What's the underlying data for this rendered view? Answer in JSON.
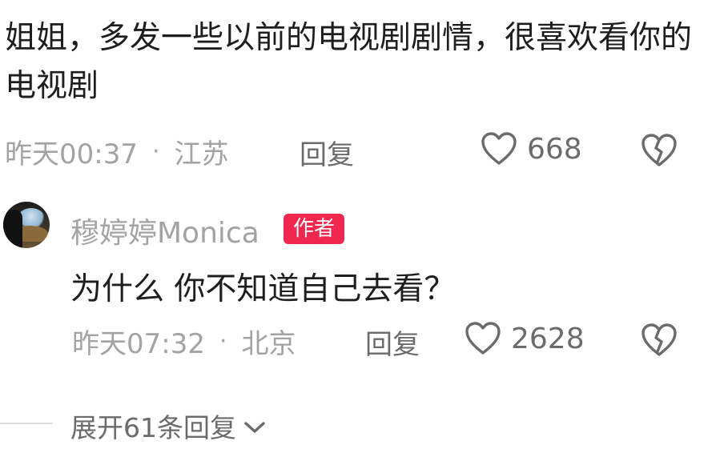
{
  "comment": {
    "text": "姐姐，多发一些以前的电视剧剧情，很喜欢看你的电视剧",
    "time": "昨天00:37",
    "separator": "·",
    "location": "江苏",
    "reply_label": "回复",
    "likes": "668"
  },
  "reply": {
    "username": "穆婷婷Monica",
    "author_badge": "作者",
    "text": "为什么 你不知道自己去看？",
    "time": "昨天07:32",
    "separator": "·",
    "location": "北京",
    "reply_label": "回复",
    "likes": "2628"
  },
  "expand": {
    "label": "展开61条回复"
  },
  "icons": {
    "like": "heart-outline-icon",
    "dislike": "broken-heart-icon",
    "expand": "chevron-down-icon"
  },
  "colors": {
    "author_badge_bg": "#f0284f",
    "meta_text": "#a3a3a3",
    "action_text": "#6b6b6b"
  }
}
